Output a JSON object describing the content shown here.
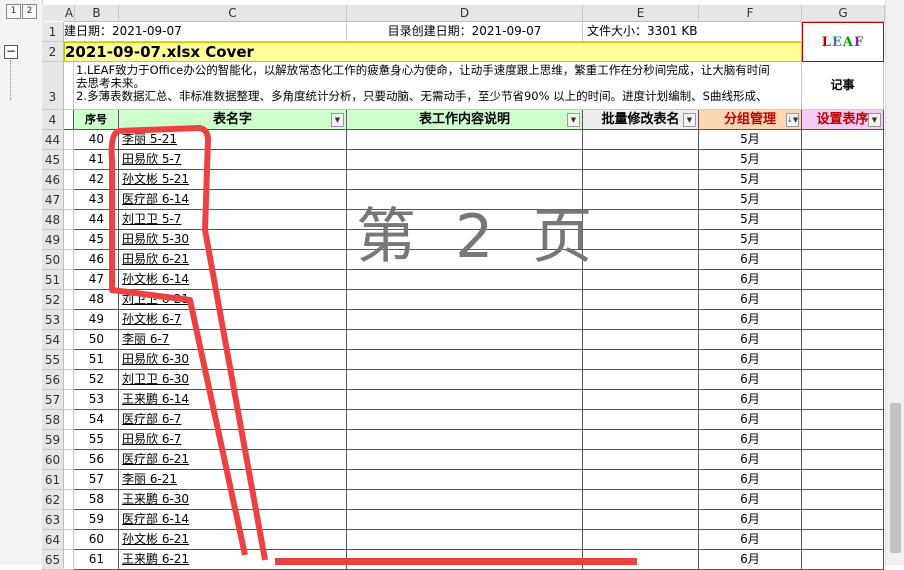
{
  "outline": {
    "levels": [
      "1",
      "2"
    ],
    "collapse_symbol": "−"
  },
  "columns": [
    "A",
    "B",
    "C",
    "D",
    "E",
    "F",
    "G"
  ],
  "info_row": {
    "created": "建日期：2021-09-07",
    "dir_created": "目录创建日期：2021-09-07",
    "file_size": "文件大小：3301 KB"
  },
  "logo": {
    "letters": [
      "L",
      "E",
      "A",
      "F"
    ],
    "colors": [
      "#c00000",
      "#2e75b6",
      "#00a000",
      "#7030a0"
    ]
  },
  "title": "2021-09-07.xlsx  Cover",
  "notes": {
    "line1": "1.LEAF致力于Office办公的智能化，以解放常态化工作的疲惫身心为使命，让动手速度跟上思维，繁重工作在分秒间完成，让大脑有时间",
    "line1b": "去思考未来。",
    "line2": "2.多薄表数据汇总、非标准数据整理、多角度统计分析，只要动脑、无需动手，至少节省90% 以上的时间。进度计划编制、S曲线形成、",
    "side": "记事"
  },
  "headers": {
    "seq": "序号",
    "name": "表名字",
    "desc": "表工作内容说明",
    "batch": "批量修改表名",
    "group": "分组管理",
    "setting": "设置表序"
  },
  "header_row_nums": [
    "1",
    "2",
    "3",
    "4"
  ],
  "rows": [
    {
      "row": "44",
      "seq": "40",
      "name": "李丽 5-21",
      "group": "5月"
    },
    {
      "row": "45",
      "seq": "41",
      "name": "田易欣 5-7",
      "group": "5月"
    },
    {
      "row": "46",
      "seq": "42",
      "name": "孙文彬 5-21",
      "group": "5月"
    },
    {
      "row": "47",
      "seq": "43",
      "name": "医疗部 6-14",
      "group": "5月"
    },
    {
      "row": "48",
      "seq": "44",
      "name": "刘卫卫 5-7",
      "group": "5月"
    },
    {
      "row": "49",
      "seq": "45",
      "name": "田易欣 5-30",
      "group": "5月"
    },
    {
      "row": "50",
      "seq": "46",
      "name": "田易欣 6-21",
      "group": "6月"
    },
    {
      "row": "51",
      "seq": "47",
      "name": "孙文彬 6-14",
      "group": "6月"
    },
    {
      "row": "52",
      "seq": "48",
      "name": "刘卫卫 6-21",
      "group": "6月"
    },
    {
      "row": "53",
      "seq": "49",
      "name": "孙文彬 6-7",
      "group": "6月"
    },
    {
      "row": "54",
      "seq": "50",
      "name": "李丽 6-7",
      "group": "6月"
    },
    {
      "row": "55",
      "seq": "51",
      "name": "田易欣 6-30",
      "group": "6月"
    },
    {
      "row": "56",
      "seq": "52",
      "name": "刘卫卫 6-30",
      "group": "6月"
    },
    {
      "row": "57",
      "seq": "53",
      "name": "王来鹏 6-14",
      "group": "6月"
    },
    {
      "row": "58",
      "seq": "54",
      "name": "医疗部 6-7",
      "group": "6月"
    },
    {
      "row": "59",
      "seq": "55",
      "name": "田易欣 6-7",
      "group": "6月"
    },
    {
      "row": "60",
      "seq": "56",
      "name": "医疗部 6-21",
      "group": "6月"
    },
    {
      "row": "61",
      "seq": "57",
      "name": "李丽 6-21",
      "group": "6月"
    },
    {
      "row": "62",
      "seq": "58",
      "name": "王来鹏 6-30",
      "group": "6月"
    },
    {
      "row": "63",
      "seq": "59",
      "name": "医疗部 6-14",
      "group": "6月"
    },
    {
      "row": "64",
      "seq": "60",
      "name": "孙文彬 6-21",
      "group": "6月"
    },
    {
      "row": "65",
      "seq": "61",
      "name": "王来鹏 6-21",
      "group": "6月"
    }
  ],
  "watermark": "第 2 页",
  "annotation_color": "#ec4141"
}
